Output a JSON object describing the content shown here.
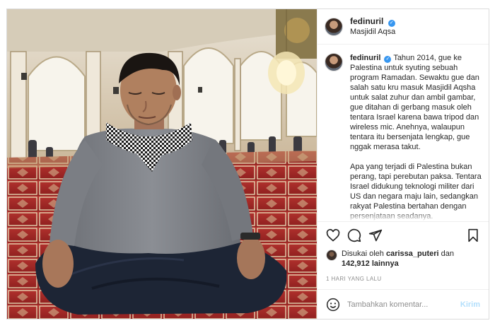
{
  "post": {
    "username": "fedinuril",
    "verified": true,
    "location": "Masjidil Aqsa",
    "caption_username": "fedinuril",
    "caption_text": "Tahun 2014, gue ke Palestina untuk syuting sebuah program Ramadan. Sewaktu gue dan salah satu kru masuk Masjidil Aqsha untuk salat zuhur dan ambil gambar, gue ditahan di gerbang masuk oleh tentara Israel karena bawa tripod dan wireless mic. Anehnya, walaupun tentara itu bersenjata lengkap, gue nggak merasa takut.\n\nApa yang terjadi di Palestina bukan perang, tapi perebutan paksa. Tentara Israel didukung teknologi militer dari US dan negara maju lain, sedangkan rakyat Palestina bertahan dengan persenjataan seadanya.\n\nIdeologi agama digunakan sebagai",
    "likes_prefix": "Disukai oleh",
    "liked_by": "carissa_puteri",
    "likes_joiner": "dan",
    "likes_count": "142,912",
    "likes_suffix": "lainnya",
    "time": "1 HARI YANG LALU"
  },
  "comment": {
    "placeholder": "Tambahkan komentar...",
    "post_label": "Kirim"
  },
  "icons": {
    "like": "heart-icon",
    "comment": "comment-icon",
    "share": "share-icon",
    "save": "bookmark-icon",
    "emoji": "emoji-icon",
    "verified": "verified-badge-icon"
  },
  "colors": {
    "verified": "#3897f0",
    "post_button_disabled": "#b2dffc",
    "border": "#dbdbdb",
    "muted": "#8e8e8e"
  }
}
